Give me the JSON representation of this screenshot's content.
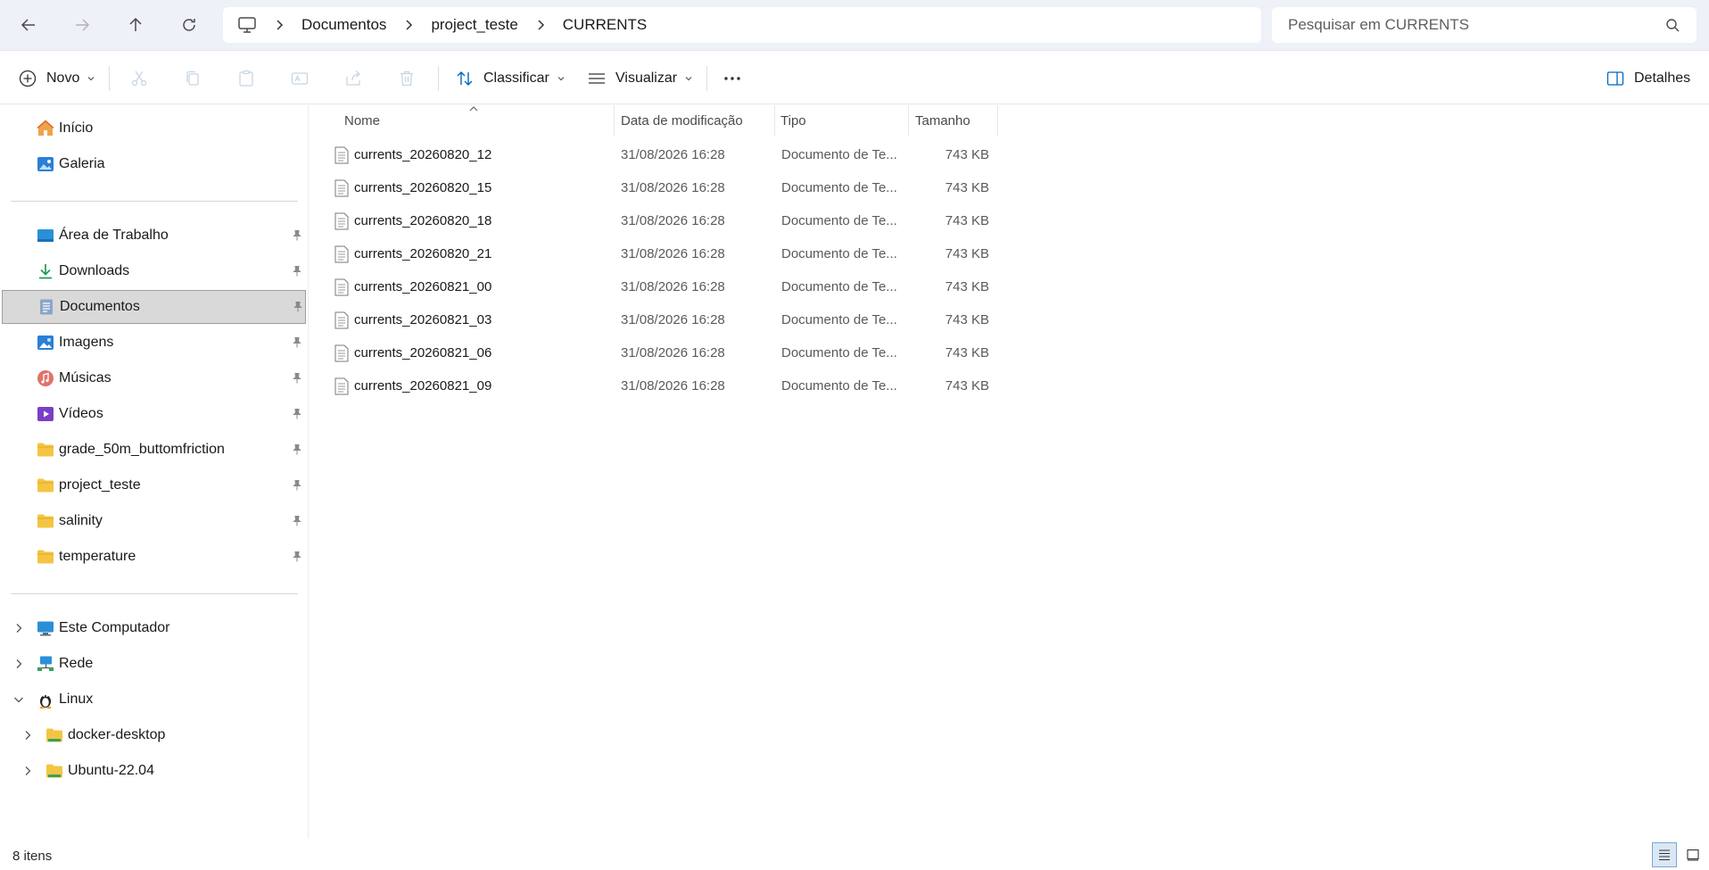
{
  "nav": {
    "back_icon": "arrow-left-icon",
    "forward_icon": "arrow-right-icon",
    "up_icon": "arrow-up-icon",
    "refresh_icon": "refresh-icon"
  },
  "breadcrumb": [
    "Documentos",
    "project_teste",
    "CURRENTS"
  ],
  "search": {
    "placeholder": "Pesquisar em CURRENTS"
  },
  "toolbar": {
    "new_label": "Novo",
    "sort_label": "Classificar",
    "view_label": "Visualizar",
    "details_label": "Detalhes"
  },
  "sidebar": {
    "quick": [
      {
        "label": "Início",
        "icon": "home-icon"
      },
      {
        "label": "Galeria",
        "icon": "gallery-icon"
      }
    ],
    "pinned": [
      {
        "label": "Área de Trabalho",
        "icon": "desktop-icon"
      },
      {
        "label": "Downloads",
        "icon": "download-icon"
      },
      {
        "label": "Documentos",
        "icon": "documents-icon",
        "selected": true
      },
      {
        "label": "Imagens",
        "icon": "pictures-icon"
      },
      {
        "label": "Músicas",
        "icon": "music-icon"
      },
      {
        "label": "Vídeos",
        "icon": "videos-icon"
      },
      {
        "label": "grade_50m_buttomfriction",
        "icon": "folder-icon"
      },
      {
        "label": "project_teste",
        "icon": "folder-icon"
      },
      {
        "label": "salinity",
        "icon": "folder-icon"
      },
      {
        "label": "temperature",
        "icon": "folder-icon"
      }
    ],
    "tree": [
      {
        "label": "Este Computador",
        "icon": "computer-icon",
        "expanded": false
      },
      {
        "label": "Rede",
        "icon": "network-icon",
        "expanded": false
      },
      {
        "label": "Linux",
        "icon": "linux-icon",
        "expanded": true
      },
      {
        "label": "docker-desktop",
        "icon": "linux-folder-icon",
        "expanded": false
      },
      {
        "label": "Ubuntu-22.04",
        "icon": "linux-folder-icon",
        "expanded": false
      }
    ]
  },
  "columns": {
    "name": "Nome",
    "date": "Data de modificação",
    "type": "Tipo",
    "size": "Tamanho"
  },
  "files": [
    {
      "name": "currents_20260820_12",
      "date": "31/08/2026 16:28",
      "type": "Documento de Te...",
      "size": "743 KB"
    },
    {
      "name": "currents_20260820_15",
      "date": "31/08/2026 16:28",
      "type": "Documento de Te...",
      "size": "743 KB"
    },
    {
      "name": "currents_20260820_18",
      "date": "31/08/2026 16:28",
      "type": "Documento de Te...",
      "size": "743 KB"
    },
    {
      "name": "currents_20260820_21",
      "date": "31/08/2026 16:28",
      "type": "Documento de Te...",
      "size": "743 KB"
    },
    {
      "name": "currents_20260821_00",
      "date": "31/08/2026 16:28",
      "type": "Documento de Te...",
      "size": "743 KB"
    },
    {
      "name": "currents_20260821_03",
      "date": "31/08/2026 16:28",
      "type": "Documento de Te...",
      "size": "743 KB"
    },
    {
      "name": "currents_20260821_06",
      "date": "31/08/2026 16:28",
      "type": "Documento de Te...",
      "size": "743 KB"
    },
    {
      "name": "currents_20260821_09",
      "date": "31/08/2026 16:28",
      "type": "Documento de Te...",
      "size": "743 KB"
    }
  ],
  "status": {
    "item_count": "8 itens"
  },
  "colors": {
    "accent": "#0067c0",
    "folder": "#f4c542",
    "selection": "#d9d9d9",
    "address_bg": "#eef1f8"
  }
}
